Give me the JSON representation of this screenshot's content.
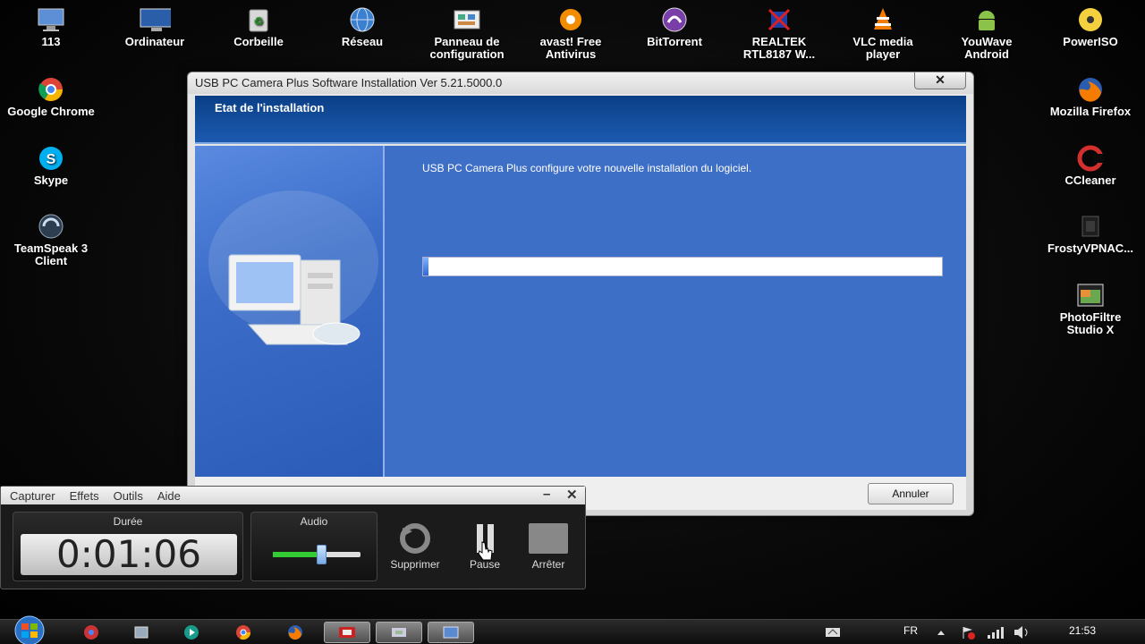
{
  "desktop": {
    "icons": [
      {
        "id": "icon-113",
        "label": "113",
        "icon": "computer-monitor-icon"
      },
      {
        "id": "icon-ordinateur",
        "label": "Ordinateur",
        "icon": "computer-icon"
      },
      {
        "id": "icon-corbeille",
        "label": "Corbeille",
        "icon": "recycle-bin-icon"
      },
      {
        "id": "icon-reseau",
        "label": "Réseau",
        "icon": "network-globe-icon"
      },
      {
        "id": "icon-panneau",
        "label": "Panneau de\nconfiguration",
        "icon": "control-panel-icon"
      },
      {
        "id": "icon-avast",
        "label": "avast! Free\nAntivirus",
        "icon": "avast-icon"
      },
      {
        "id": "icon-bittorrent",
        "label": "BitTorrent",
        "icon": "bittorrent-icon"
      },
      {
        "id": "icon-realtek",
        "label": "REALTEK\nRTL8187 W...",
        "icon": "realtek-wireless-icon"
      },
      {
        "id": "icon-vlc",
        "label": "VLC media\nplayer",
        "icon": "vlc-cone-icon"
      },
      {
        "id": "icon-youwave",
        "label": "YouWave\nAndroid",
        "icon": "android-icon"
      },
      {
        "id": "icon-poweriso",
        "label": "PowerISO",
        "icon": "poweriso-disc-icon"
      },
      {
        "id": "icon-chrome",
        "label": "Google Chrome",
        "icon": "chrome-icon"
      },
      {
        "id": "icon-skype",
        "label": "Skype",
        "icon": "skype-icon"
      },
      {
        "id": "icon-teamspeak",
        "label": "TeamSpeak 3\nClient",
        "icon": "teamspeak-icon"
      },
      {
        "id": "icon-firefox",
        "label": "Mozilla Firefox",
        "icon": "firefox-icon"
      },
      {
        "id": "icon-ccleaner",
        "label": "CCleaner",
        "icon": "ccleaner-icon"
      },
      {
        "id": "icon-frostyvpn",
        "label": "FrostyVPNAC...",
        "icon": "vpn-icon"
      },
      {
        "id": "icon-photofiltre",
        "label": "PhotoFiltre\nStudio X",
        "icon": "photofiltre-icon"
      }
    ]
  },
  "installer": {
    "title": "USB PC Camera Plus Software Installation Ver 5.21.5000.0",
    "close_glyph": "✕",
    "header": "Etat de l'installation",
    "message": "USB PC Camera Plus configure votre nouvelle installation du logiciel.",
    "progress_fraction": 0.01,
    "cancel_label": "Annuler"
  },
  "recorder": {
    "menu": [
      "Capturer",
      "Effets",
      "Outils",
      "Aide"
    ],
    "minimize_glyph": "–",
    "close_glyph": "✕",
    "duration_caption": "Durée",
    "duration_value": "0:01:06",
    "audio_caption": "Audio",
    "audio_level_fraction": 0.55,
    "buttons": {
      "delete": "Supprimer",
      "pause": "Pause",
      "stop": "Arrêter"
    }
  },
  "taskbar": {
    "language": "FR",
    "clock": "21:53"
  },
  "colors": {
    "installer_blue": "#3e6fc6",
    "header_blue": "#0a3f86",
    "progress_fill": "#2f6ad8"
  }
}
